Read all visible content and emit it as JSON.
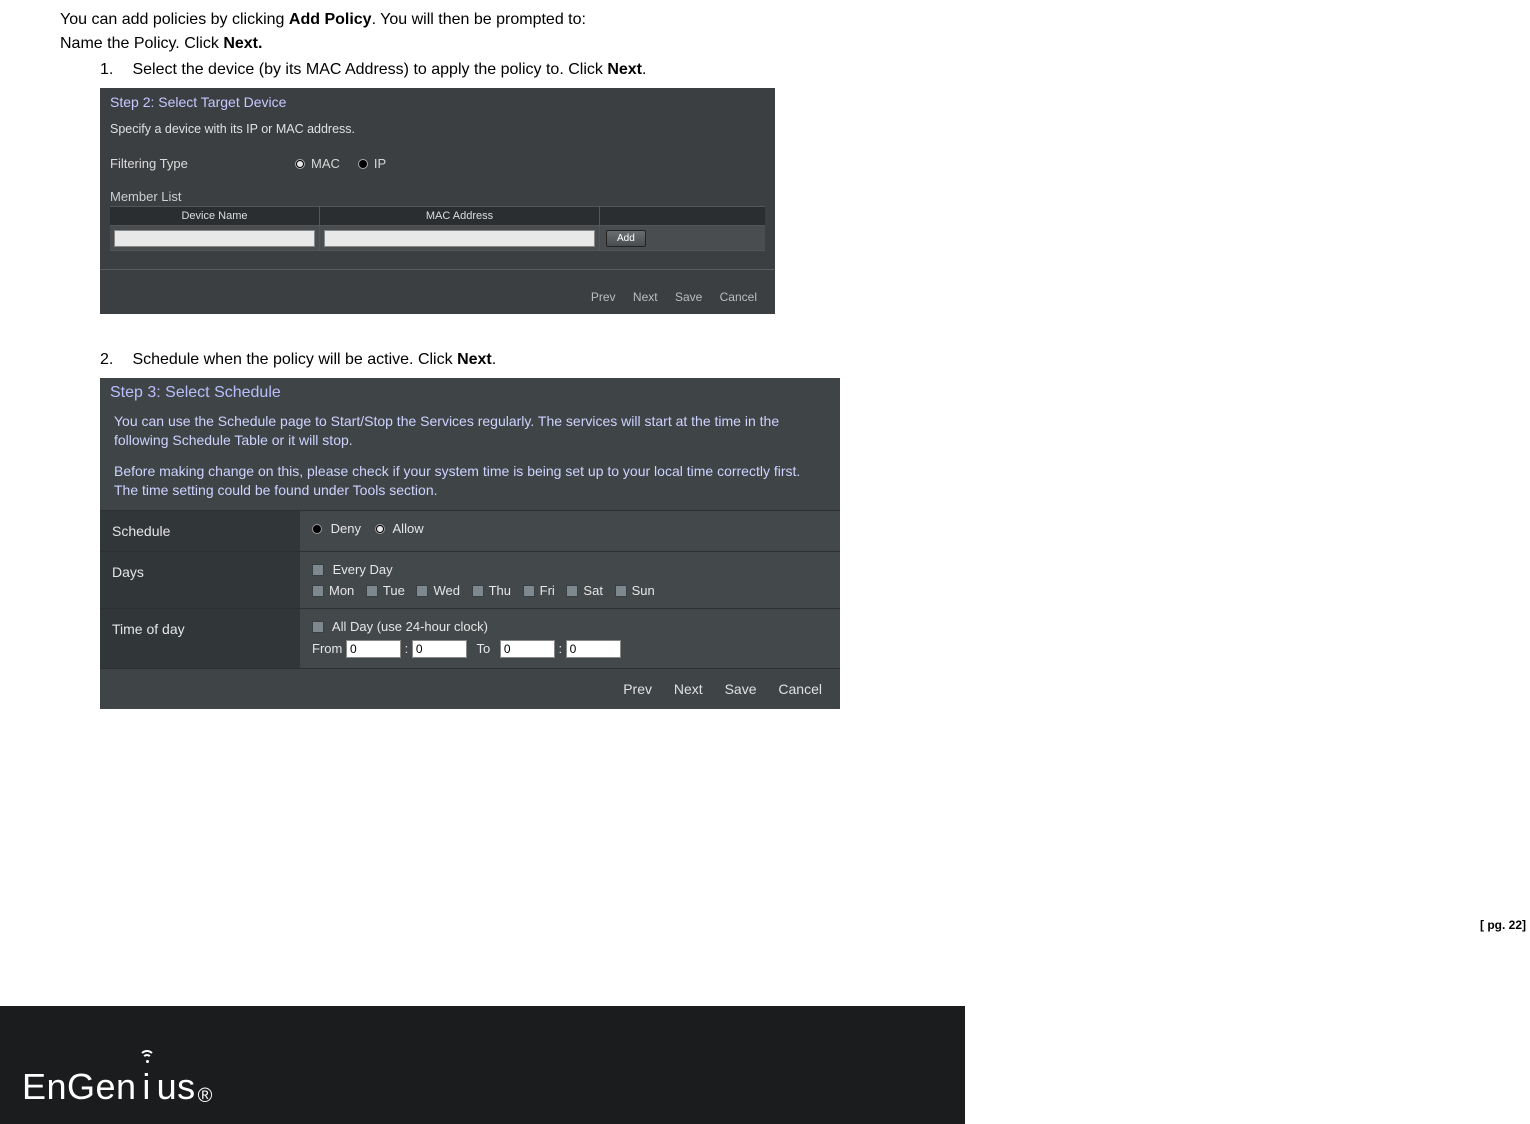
{
  "intro": {
    "line1_a": "You can add policies by clicking ",
    "line1_b": "Add Policy",
    "line1_c": ". You will then be prompted to:",
    "line2_a": "Name the Policy. Click ",
    "line2_b": "Next."
  },
  "item1": {
    "num": "1.",
    "text_a": "Select the device (by its MAC Address) to apply the policy to. Click ",
    "text_b": "Next",
    "text_c": "."
  },
  "shot1": {
    "title": "Step 2: Select Target Device",
    "sub": "Specify a device with its IP or MAC address.",
    "filter_label": "Filtering Type",
    "opt_mac": "MAC",
    "opt_ip": "IP",
    "member_list": "Member List",
    "th_device": "Device Name",
    "th_mac": "MAC Address",
    "add": "Add",
    "nav_prev": "Prev",
    "nav_next": "Next",
    "nav_save": "Save",
    "nav_cancel": "Cancel"
  },
  "item2": {
    "num": "2.",
    "text_a": "Schedule when the policy will be active. Click ",
    "text_b": "Next",
    "text_c": "."
  },
  "shot2": {
    "title": "Step 3: Select Schedule",
    "p1": "You can use the Schedule page to Start/Stop the Services regularly. The services will start at the time in the following Schedule Table or it will stop.",
    "p2": "Before making change on this, please check if your system time is being set up to your local time correctly first. The time setting could be found under Tools section.",
    "row_schedule": "Schedule",
    "deny": "Deny",
    "allow": "Allow",
    "row_days": "Days",
    "every_day": "Every Day",
    "days": [
      "Mon",
      "Tue",
      "Wed",
      "Thu",
      "Fri",
      "Sat",
      "Sun"
    ],
    "row_time": "Time of day",
    "all_day": "All Day (use 24-hour clock)",
    "from": "From",
    "to": "To",
    "t_from_h": "0",
    "t_from_m": "0",
    "t_to_h": "0",
    "t_to_m": "0",
    "nav_prev": "Prev",
    "nav_next": "Next",
    "nav_save": "Save",
    "nav_cancel": "Cancel"
  },
  "logo": {
    "part1": "EnGen",
    "part2": "i",
    "part3": "us"
  },
  "page_num": "[ pg. 22]"
}
